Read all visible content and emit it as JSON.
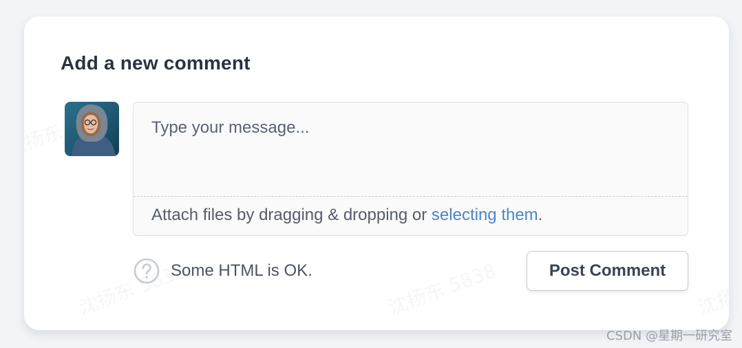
{
  "comment_form": {
    "title": "Add a new comment",
    "textarea": {
      "placeholder": "Type your message...",
      "value": ""
    },
    "attach": {
      "prefix": "Attach files by dragging & dropping or ",
      "link_label": "selecting them",
      "suffix": "."
    },
    "help": {
      "icon": "question-circle-icon",
      "text": "Some HTML is OK."
    },
    "post_button_label": "Post Comment"
  },
  "watermark": {
    "text": "沈扬东 5838"
  },
  "footer": {
    "credit": "CSDN @星期一研究室"
  },
  "colors": {
    "page_background": "#f2f4f8",
    "card_background": "#ffffff",
    "title_text": "#2b3340",
    "link": "#4a86c4",
    "border": "#dcdfe5",
    "button_border": "#c5c9d0"
  }
}
